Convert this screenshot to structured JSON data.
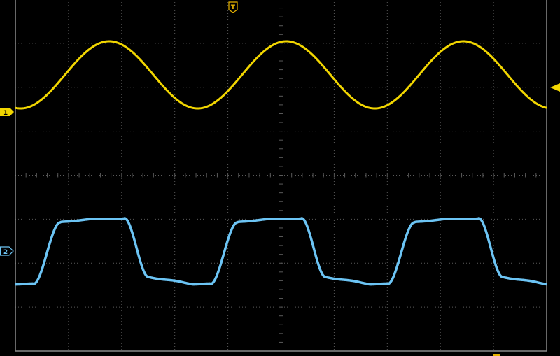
{
  "screen": {
    "background": "#000000",
    "grid_color": "#5a5a5a",
    "border_color": "#8a8a8a",
    "divisions_horizontal": 10,
    "divisions_vertical": 8,
    "subdivisions_per_division": 5
  },
  "trigger_marker": {
    "label": "T",
    "icon": "trigger-position-icon",
    "color": "#e8b400"
  },
  "trigger_level_marker": {
    "icon": "trigger-level-arrow-icon",
    "color": "#f2d600"
  },
  "channels": [
    {
      "id": "ch1",
      "label": "1",
      "icon": "channel-1-ground-marker-icon",
      "color": "#f2d600",
      "waveform": "sine",
      "cycles_visible": 3
    },
    {
      "id": "ch2",
      "label": "2",
      "icon": "channel-2-ground-marker-icon",
      "color": "#6cc4f4",
      "waveform": "rounded-square",
      "cycles_visible": 3
    }
  ]
}
